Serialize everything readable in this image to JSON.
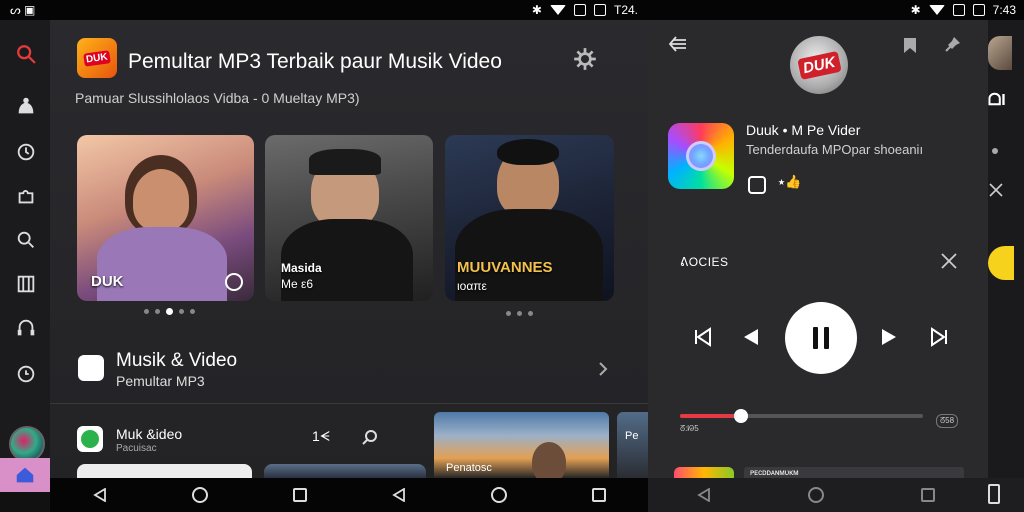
{
  "status_left": {
    "left_text": "ᔕ ▣",
    "time": "T24."
  },
  "status_right": {
    "time": "7:43"
  },
  "app": {
    "title": "Pemultar MP3 Terbaik paur Musik Video",
    "subtitle": "Pamuar Slussihlolaos Vidba - 0 Mueltay MP3)",
    "logo_text": "DUK"
  },
  "cards": [
    {
      "label": "DUK",
      "label_small": ""
    },
    {
      "label": "Masida",
      "label_small": "Me ε6"
    },
    {
      "label": "MUUVANNES",
      "label_small": "ιοαπε"
    }
  ],
  "section": {
    "title": "Musik & Video",
    "subtitle": "Pemultar MP3"
  },
  "list_row": {
    "title": "Muk &ideo",
    "subtitle": "Pacuisac",
    "count": "1ᗕ"
  },
  "thumbs": {
    "sunset_label": "Penatosc",
    "edge_label": "Pe"
  },
  "player": {
    "logo_text": "DUK",
    "track_title": "Duuk • M Pe Vider",
    "track_subtitle": "Tenderdaufa MPOpar shoeaniı",
    "track_emoji": "⭑👍",
    "queue_label": "ᕕOCIES",
    "time_left": "ᘔ:ᘘ5",
    "time_right": "ᘔ58",
    "mini_bar_text": "ᴘᴇᴄᴅᴅᴀɴᴍᴜᴋᴍ",
    "progress": 0.25
  },
  "peek": {
    "text": "ᗝI",
    "yellow_text": ""
  },
  "colors": {
    "accent_red": "#e63946",
    "search_red": "#e23b3b",
    "rail_bg": "#1b1b1d",
    "main_bg": "#2a2a2e"
  }
}
